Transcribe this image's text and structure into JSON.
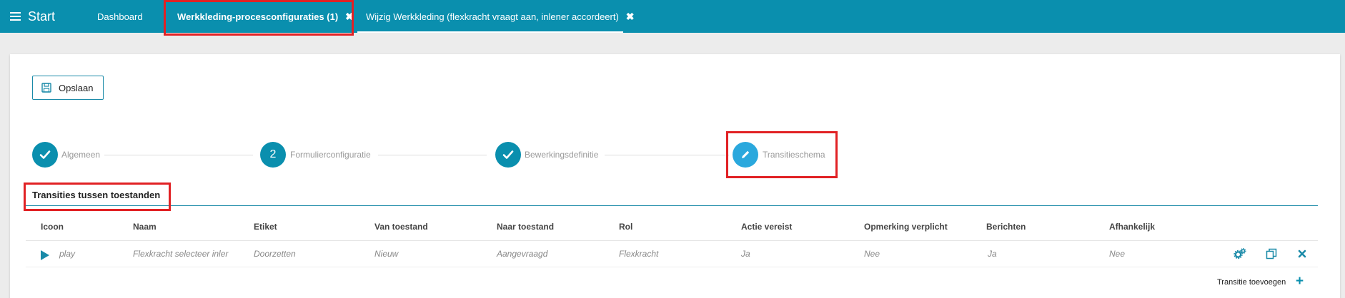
{
  "header": {
    "menu_label": "Start",
    "tabs": [
      {
        "label": "Dashboard"
      },
      {
        "label": "Werkkleding-procesconfiguraties (1)",
        "close": "✖"
      },
      {
        "label": "Wijzig Werkkleding (flexkracht vraagt aan, inlener accordeert)",
        "close": "✖"
      }
    ]
  },
  "toolbar": {
    "save_label": "Opslaan"
  },
  "stepper": {
    "steps": [
      {
        "label": "Algemeen",
        "state": "done",
        "icon": "check-icon"
      },
      {
        "label": "Formulierconfiguratie",
        "state": "numbered",
        "number": "2"
      },
      {
        "label": "Bewerkingsdefinitie",
        "state": "done",
        "icon": "check-icon"
      },
      {
        "label": "Transitieschema",
        "state": "active",
        "icon": "pencil-icon"
      }
    ]
  },
  "section": {
    "title": "Transities tussen toestanden"
  },
  "table": {
    "columns": [
      "Icoon",
      "Naam",
      "Etiket",
      "Van toestand",
      "Naar toestand",
      "Rol",
      "Actie vereist",
      "Opmerking verplicht",
      "Berichten",
      "Afhankelijk"
    ],
    "rows": [
      {
        "icon": "play-icon",
        "cells": [
          "play",
          "Flexkracht selecteer inler",
          "Doorzetten",
          "Nieuw",
          "Aangevraagd",
          "Flexkracht",
          "Ja",
          "Nee",
          "Ja",
          "Nee"
        ],
        "actions": [
          "settings-icon",
          "copy-icon",
          "delete-icon"
        ]
      }
    ],
    "add_label": "Transitie toevoegen",
    "add_icon": "plus-icon"
  },
  "colors": {
    "header_bg": "#0a8fae",
    "accent": "#1a8aa8",
    "active_step": "#2aa8dd",
    "highlight": "#e12124"
  }
}
